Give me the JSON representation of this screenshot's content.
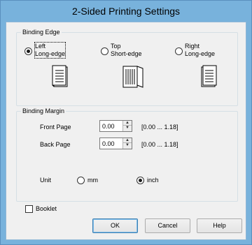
{
  "window": {
    "title": "2-Sided Printing Settings"
  },
  "binding_edge": {
    "label": "Binding Edge",
    "options": [
      {
        "line1": "Left",
        "line2": "Long-edge",
        "selected": true,
        "icon": "document-left-binding-icon"
      },
      {
        "line1": "Top",
        "line2": "Short-edge",
        "selected": false,
        "icon": "document-top-binding-icon"
      },
      {
        "line1": "Right",
        "line2": "Long-edge",
        "selected": false,
        "icon": "document-right-binding-icon"
      }
    ]
  },
  "binding_margin": {
    "label": "Binding Margin",
    "front_page": {
      "label": "Front Page",
      "value": "0.00",
      "range": "[0.00 ... 1.18]"
    },
    "back_page": {
      "label": "Back Page",
      "value": "0.00",
      "range": "[0.00 ... 1.18]"
    },
    "unit": {
      "label": "Unit",
      "mm": "mm",
      "inch": "inch",
      "selected": "inch"
    }
  },
  "booklet": {
    "label": "Booklet",
    "checked": false
  },
  "buttons": {
    "ok": "OK",
    "cancel": "Cancel",
    "help": "Help"
  }
}
